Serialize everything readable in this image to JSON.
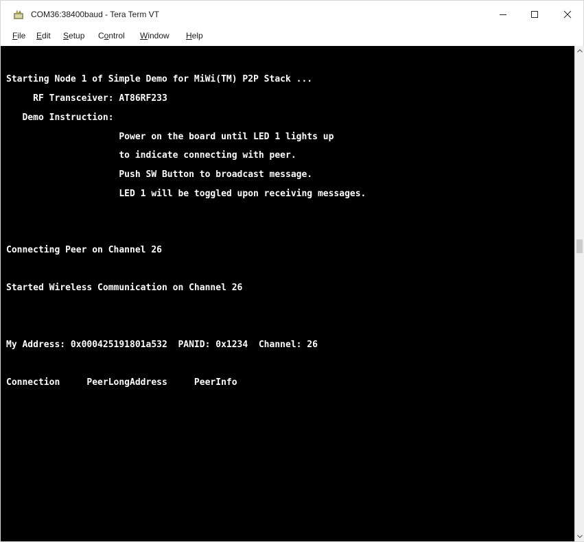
{
  "window": {
    "title": "COM36:38400baud - Tera Term VT",
    "icon": "tera-term-icon",
    "controls": {
      "minimize": "minimize-icon",
      "maximize": "maximize-icon",
      "close": "close-icon"
    }
  },
  "menu": [
    {
      "accel": "F",
      "rest": "ile"
    },
    {
      "accel": "E",
      "rest": "dit"
    },
    {
      "accel": "S",
      "rest": "etup"
    },
    {
      "pre": "C",
      "accel": "o",
      "rest": "ntrol"
    },
    {
      "accel": "W",
      "rest": "indow"
    },
    {
      "accel": "H",
      "rest": "elp"
    }
  ],
  "terminal": {
    "lines": [
      "Starting Node 1 of Simple Demo for MiWi(TM) P2P Stack ...",
      "     RF Transceiver: AT86RF233",
      "   Demo Instruction:",
      "                     Power on the board until LED 1 lights up",
      "                     to indicate connecting with peer.",
      "                     Push SW Button to broadcast message.",
      "                     LED 1 will be toggled upon receiving messages.",
      "Connecting Peer on Channel 26",
      "Started Wireless Communication on Channel 26",
      "My Address: 0x000425191801a532  PANID: 0x1234  Channel: 26",
      "Connection     PeerLongAddress     PeerInfo"
    ],
    "colors": {
      "background": "#000000",
      "foreground": "#ffffff"
    }
  }
}
